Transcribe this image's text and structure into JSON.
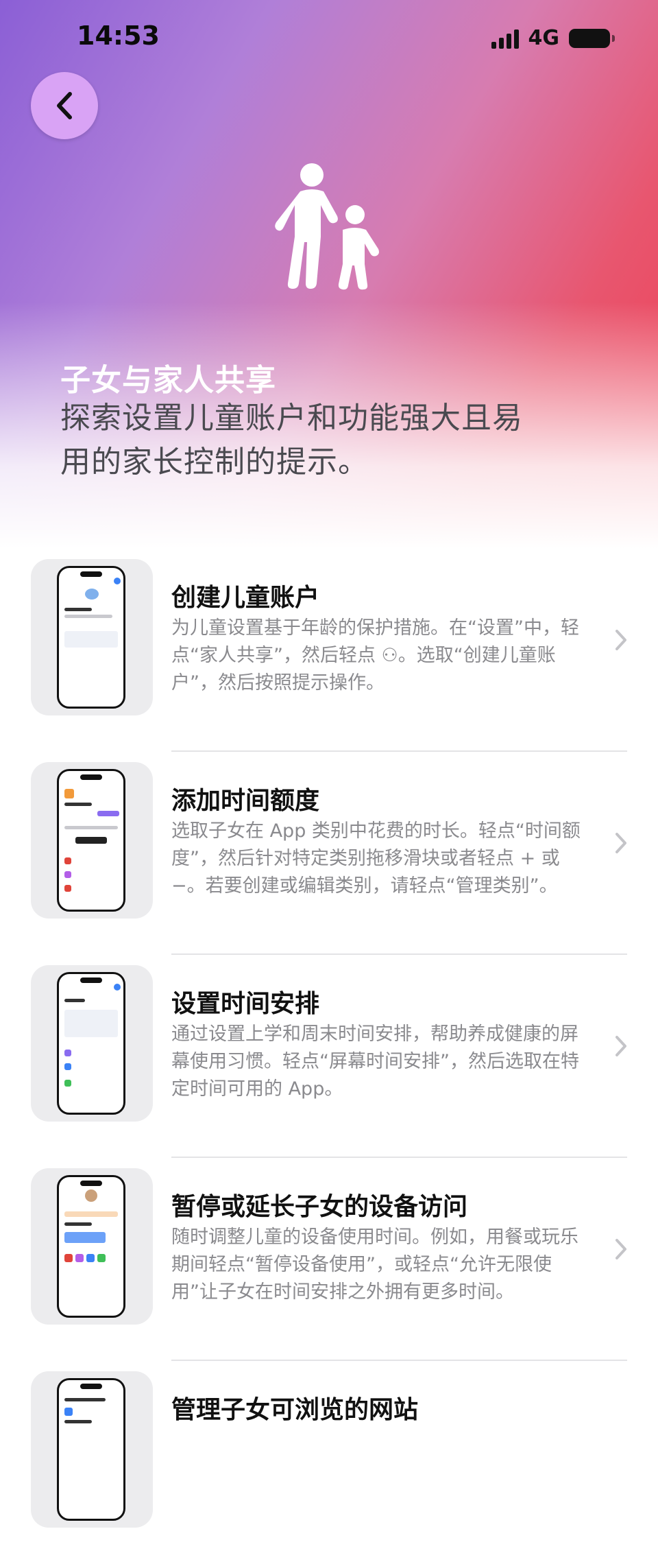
{
  "status_bar": {
    "time": "14:53",
    "network": "4G"
  },
  "header": {
    "back_icon": "chevron-left-icon",
    "hero_icon": "parent-child-icon",
    "title": "子女与家人共享",
    "subtitle": "探索设置儿童账户和功能强大且易用的家长控制的提示。"
  },
  "items": [
    {
      "title": "创建儿童账户",
      "description": "为儿童设置基于年龄的保护措施。在“设置”中，轻点“家人共享”，然后轻点 ⚇。选取“创建儿童账户”，然后按照提示操作。"
    },
    {
      "title": "添加时间额度",
      "description": "选取子女在 App 类别中花费的时长。轻点“时间额度”，然后针对特定类别拖移滑块或者轻点 + 或 −。若要创建或编辑类别，请轻点“管理类别”。"
    },
    {
      "title": "设置时间安排",
      "description": "通过设置上学和周末时间安排，帮助养成健康的屏幕使用习惯。轻点“屏幕时间安排”，然后选取在特定时间可用的 App。"
    },
    {
      "title": "暂停或延长子女的设备访问",
      "description": "随时调整儿童的设备使用时间。例如，用餐或玩乐期间轻点“暂停设备使用”，或轻点“允许无限使用”让子女在时间安排之外拥有更多时间。"
    },
    {
      "title": "管理子女可浏览的网站",
      "description": ""
    }
  ]
}
